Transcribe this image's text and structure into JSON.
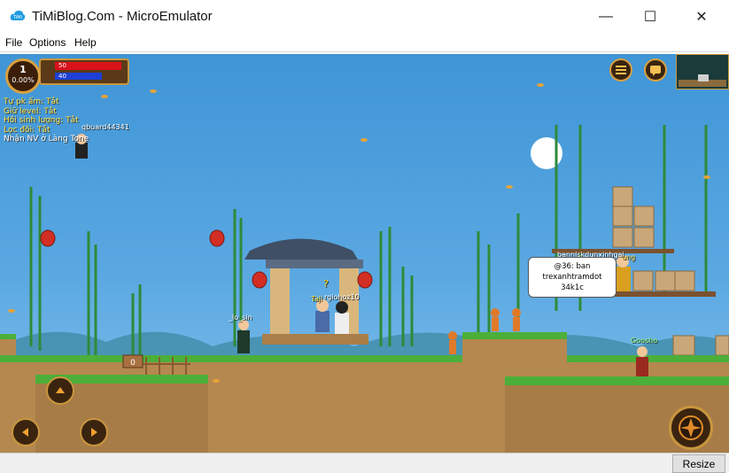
{
  "window": {
    "title": "TiMiBlog.Com - MicroEmulator",
    "controls": [
      "—",
      "☐",
      "✕"
    ]
  },
  "menu": [
    {
      "label": "File"
    },
    {
      "label": "Options"
    },
    {
      "label": "Help"
    }
  ],
  "hud": {
    "level": "1",
    "exp_percent": "0.00%",
    "hp": "50",
    "mp": "40",
    "hp_fill": 1.0,
    "mp_fill": 1.0
  },
  "notices": [
    "Tự pk ấm: Tắt",
    "Giữ level: Tắt",
    "Hồi sinh lượng: Tắt",
    "Lọc đồi: Tắt",
    "Nhận NV ở Làng Tone"
  ],
  "players": {
    "flying": "qbuard44341",
    "left_ground": "_lo_sin",
    "center_a": "Taji",
    "center_b": "rgiohoz10",
    "platform": "bannlskdunxinhgai",
    "platform_b": "ung",
    "guard": "Goosho"
  },
  "chat_bubble": [
    "@36: ban",
    "trexanhtramdot",
    "34k1c"
  ],
  "status": {
    "resize_label": "Resize"
  },
  "colors": {
    "sky": "#4a9ddb",
    "hp_bar": "#d9121a",
    "mp_bar": "#1e3fd6",
    "notice_text": "#ffe34a",
    "grass": "#4caf3a",
    "ground": "#b4884f"
  }
}
